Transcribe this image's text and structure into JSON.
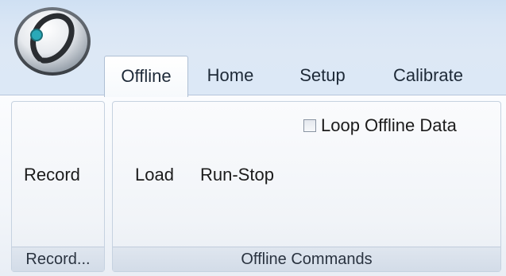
{
  "tabs": [
    {
      "label": "Offline",
      "active": true
    },
    {
      "label": "Home",
      "active": false
    },
    {
      "label": "Setup",
      "active": false
    },
    {
      "label": "Calibrate",
      "active": false
    }
  ],
  "groups": {
    "record": {
      "button_label": "Record",
      "footer": "Record..."
    },
    "offline_commands": {
      "load_label": "Load",
      "run_stop_label": "Run-Stop",
      "loop_checkbox_label": "Loop Offline Data",
      "loop_checked": false,
      "footer": "Offline Commands"
    }
  },
  "icons": {
    "app_orb": "application-orb-icon"
  },
  "colors": {
    "ribbon_blue": "#dce8f6",
    "border": "#b6c6da"
  }
}
